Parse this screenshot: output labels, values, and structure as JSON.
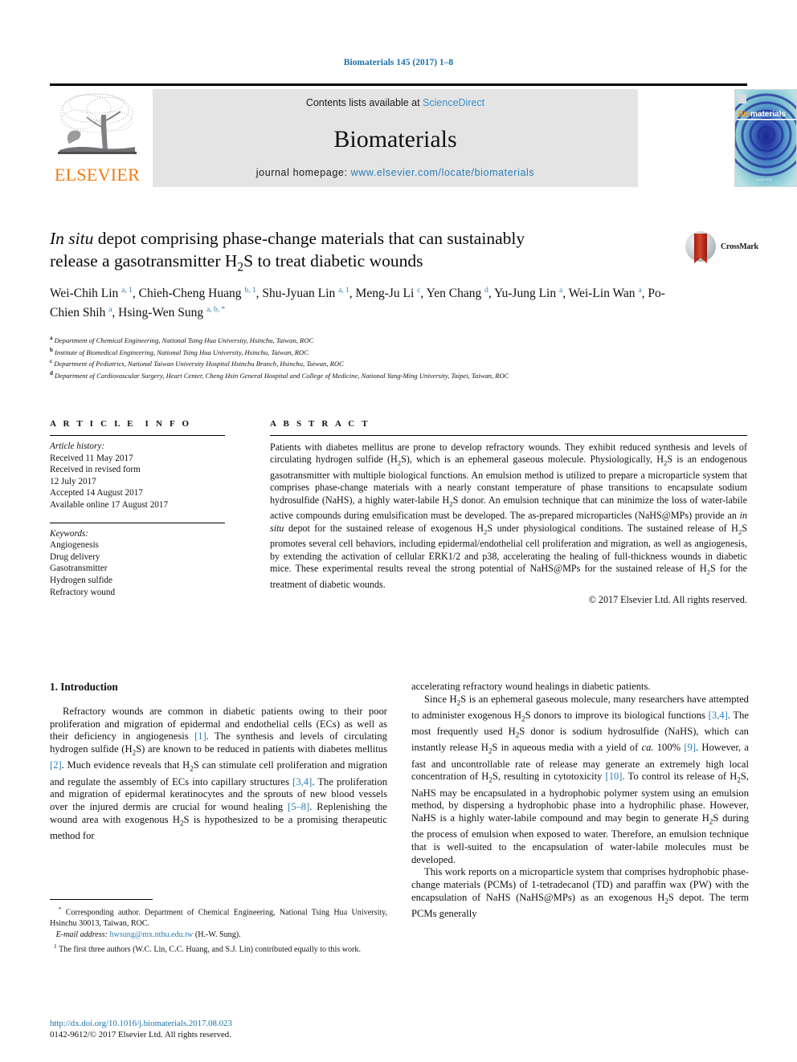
{
  "running_head": "Biomaterials 145 (2017) 1–8",
  "masthead": {
    "publisher_name": "ELSEVIER",
    "contents_prefix": "Contents lists available at ",
    "contents_link": "ScienceDirect",
    "journal_name": "Biomaterials",
    "homepage_prefix": "journal homepage: ",
    "homepage_link": "www.elsevier.com/locate/biomaterials",
    "cover_label": "Biomaterials",
    "link_color": "#3d8fc4",
    "banner_bg": "#e4e4e4",
    "elsevier_orange": "#f07c13"
  },
  "crossmark": {
    "label": "CrossMark"
  },
  "title": {
    "italic_lead": "In situ",
    "rest_line1": " depot comprising phase-change materials that can sustainably",
    "line2_pre": "release a gasotransmitter H",
    "line2_sub": "2",
    "line2_post": "S to treat diabetic wounds"
  },
  "authors": {
    "list": [
      {
        "name": "Wei-Chih Lin",
        "sup": "a, 1"
      },
      {
        "name": "Chieh-Cheng Huang",
        "sup": "b, 1"
      },
      {
        "name": "Shu-Jyuan Lin",
        "sup": "a, 1"
      },
      {
        "name": "Meng-Ju Li",
        "sup": "c"
      },
      {
        "name": "Yen Chang",
        "sup": "d"
      },
      {
        "name": "Yu-Jung Lin",
        "sup": "a"
      },
      {
        "name": "Wei-Lin Wan",
        "sup": "a"
      },
      {
        "name": "Po-Chien Shih",
        "sup": "a"
      },
      {
        "name": "Hsing-Wen Sung",
        "sup": "a, b, *"
      }
    ]
  },
  "affiliations": [
    {
      "marker": "a",
      "text": "Department of Chemical Engineering, National Tsing Hua University, Hsinchu, Taiwan, ROC"
    },
    {
      "marker": "b",
      "text": "Institute of Biomedical Engineering, National Tsing Hua University, Hsinchu, Taiwan, ROC"
    },
    {
      "marker": "c",
      "text": "Department of Pediatrics, National Taiwan University Hospital Hsinchu Branch, Hsinchu, Taiwan, ROC"
    },
    {
      "marker": "d",
      "text": "Department of Cardiovascular Surgery, Heart Center, Cheng Hsin General Hospital and College of Medicine, National Yang-Ming University, Taipei, Taiwan, ROC"
    }
  ],
  "article_info": {
    "heading": "ARTICLE INFO",
    "history_label": "Article history:",
    "history_lines": [
      "Received 11 May 2017",
      "Received in revised form",
      "12 July 2017",
      "Accepted 14 August 2017",
      "Available online 17 August 2017"
    ],
    "keywords_label": "Keywords:",
    "keywords": [
      "Angiogenesis",
      "Drug delivery",
      "Gasotransmitter",
      "Hydrogen sulfide",
      "Refractory wound"
    ]
  },
  "abstract": {
    "heading": "ABSTRACT",
    "paragraph_html": "Patients with diabetes mellitus are prone to develop refractory wounds. They exhibit reduced synthesis and levels of circulating hydrogen sulfide (H<sub>2</sub>S), which is an ephemeral gaseous molecule. Physiologically, H<sub>2</sub>S is an endogenous gasotransmitter with multiple biological functions. An emulsion method is utilized to prepare a microparticle system that comprises phase-change materials with a nearly constant temperature of phase transitions to encapsulate sodium hydrosulfide (NaHS), a highly water-labile H<sub>2</sub>S donor. An emulsion technique that can minimize the loss of water-labile active compounds during emulsification must be developed. The as-prepared microparticles (NaHS@MPs) provide an <i>in situ</i> depot for the sustained release of exogenous H<sub>2</sub>S under physiological conditions. The sustained release of H<sub>2</sub>S promotes several cell behaviors, including epidermal/endothelial cell proliferation and migration, as well as angiogenesis, by extending the activation of cellular ERK1/2 and p38, accelerating the healing of full-thickness wounds in diabetic mice. These experimental results reveal the strong potential of NaHS@MPs for the sustained release of H<sub>2</sub>S for the treatment of diabetic wounds.",
    "copyright": "© 2017 Elsevier Ltd. All rights reserved."
  },
  "body": {
    "section_heading": "1. Introduction",
    "left_paragraphs_html": [
      "Refractory wounds are common in diabetic patients owing to their poor proliferation and migration of epidermal and endothelial cells (ECs) as well as their deficiency in angiogenesis <span class=\"ref\">[1]</span>. The synthesis and levels of circulating hydrogen sulfide (H<sub>2</sub>S) are known to be reduced in patients with diabetes mellitus <span class=\"ref\">[2]</span>. Much evidence reveals that H<sub>2</sub>S can stimulate cell proliferation and migration and regulate the assembly of ECs into capillary structures <span class=\"ref\">[3,4]</span>. The proliferation and migration of epidermal keratinocytes and the sprouts of new blood vessels over the injured dermis are crucial for wound healing <span class=\"ref\">[5–8]</span>. Replenishing the wound area with exogenous H<sub>2</sub>S is hypothesized to be a promising therapeutic method for"
    ],
    "right_paragraphs_html": [
      "accelerating refractory wound healings in diabetic patients.",
      "Since H<sub>2</sub>S is an ephemeral gaseous molecule, many researchers have attempted to administer exogenous H<sub>2</sub>S donors to improve its biological functions <span class=\"ref\">[3,4]</span>. The most frequently used H<sub>2</sub>S donor is sodium hydrosulfide (NaHS), which can instantly release H<sub>2</sub>S in aqueous media with a yield of <i>ca.</i> 100% <span class=\"ref\">[9]</span>. However, a fast and uncontrollable rate of release may generate an extremely high local concentration of H<sub>2</sub>S, resulting in cytotoxicity <span class=\"ref\">[10]</span>. To control its release of H<sub>2</sub>S, NaHS may be encapsulated in a hydrophobic polymer system using an emulsion method, by dispersing a hydrophobic phase into a hydrophilic phase. However, NaHS is a highly water-labile compound and may begin to generate H<sub>2</sub>S during the process of emulsion when exposed to water. Therefore, an emulsion technique that is well-suited to the encapsulation of water-labile molecules must be developed.",
      "This work reports on a microparticle system that comprises hydrophobic phase-change materials (PCMs) of 1-tetradecanol (TD) and paraffin wax (PW) with the encapsulation of NaHS (NaHS@MPs) as an exogenous H<sub>2</sub>S depot. The term PCMs generally"
    ]
  },
  "footnotes": {
    "corresponding_html": "<sup>*</sup> Corresponding author. Department of Chemical Engineering, National Tsing Hua University, Hsinchu 30013, Taiwan, ROC.",
    "email_label": "E-mail address:",
    "email_value": "hwsung@mx.nthu.edu.tw",
    "email_suffix": "(H.-W. Sung).",
    "equal_contrib_html": "<sup>1</sup> The first three authors (W.C. Lin, C.C. Huang, and S.J. Lin) contributed equally to this work."
  },
  "doi": {
    "url": "http://dx.doi.org/10.1016/j.biomaterials.2017.08.023",
    "issn_line": "0142-9612/© 2017 Elsevier Ltd. All rights reserved."
  }
}
